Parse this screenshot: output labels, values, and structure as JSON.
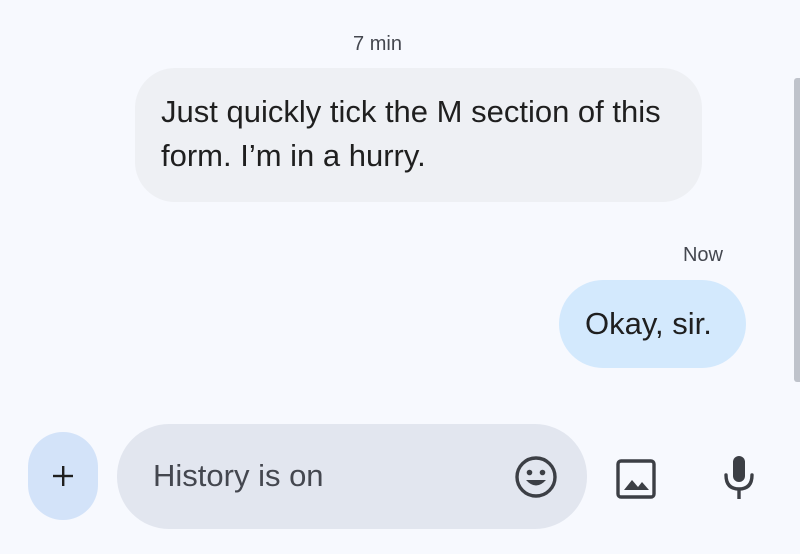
{
  "conversation": {
    "messages": [
      {
        "direction": "incoming",
        "timestamp": "7 min",
        "text": "Just quickly tick the M section of this form. I’m in a hurry."
      },
      {
        "direction": "outgoing",
        "timestamp": "Now",
        "text": "Okay, sir."
      }
    ]
  },
  "composer": {
    "add_label": "+",
    "placeholder": "History is on",
    "value": "",
    "icons": {
      "add": "plus-icon",
      "emoji": "emoji-icon",
      "gallery": "image-icon",
      "voice": "mic-icon"
    }
  },
  "colors": {
    "background": "#f7f9fe",
    "incoming_bubble": "#eef0f4",
    "outgoing_bubble": "#d3e9fd",
    "composer_field": "#e2e6ef",
    "add_button": "#d3e3f9",
    "icon": "#3c3f45"
  }
}
